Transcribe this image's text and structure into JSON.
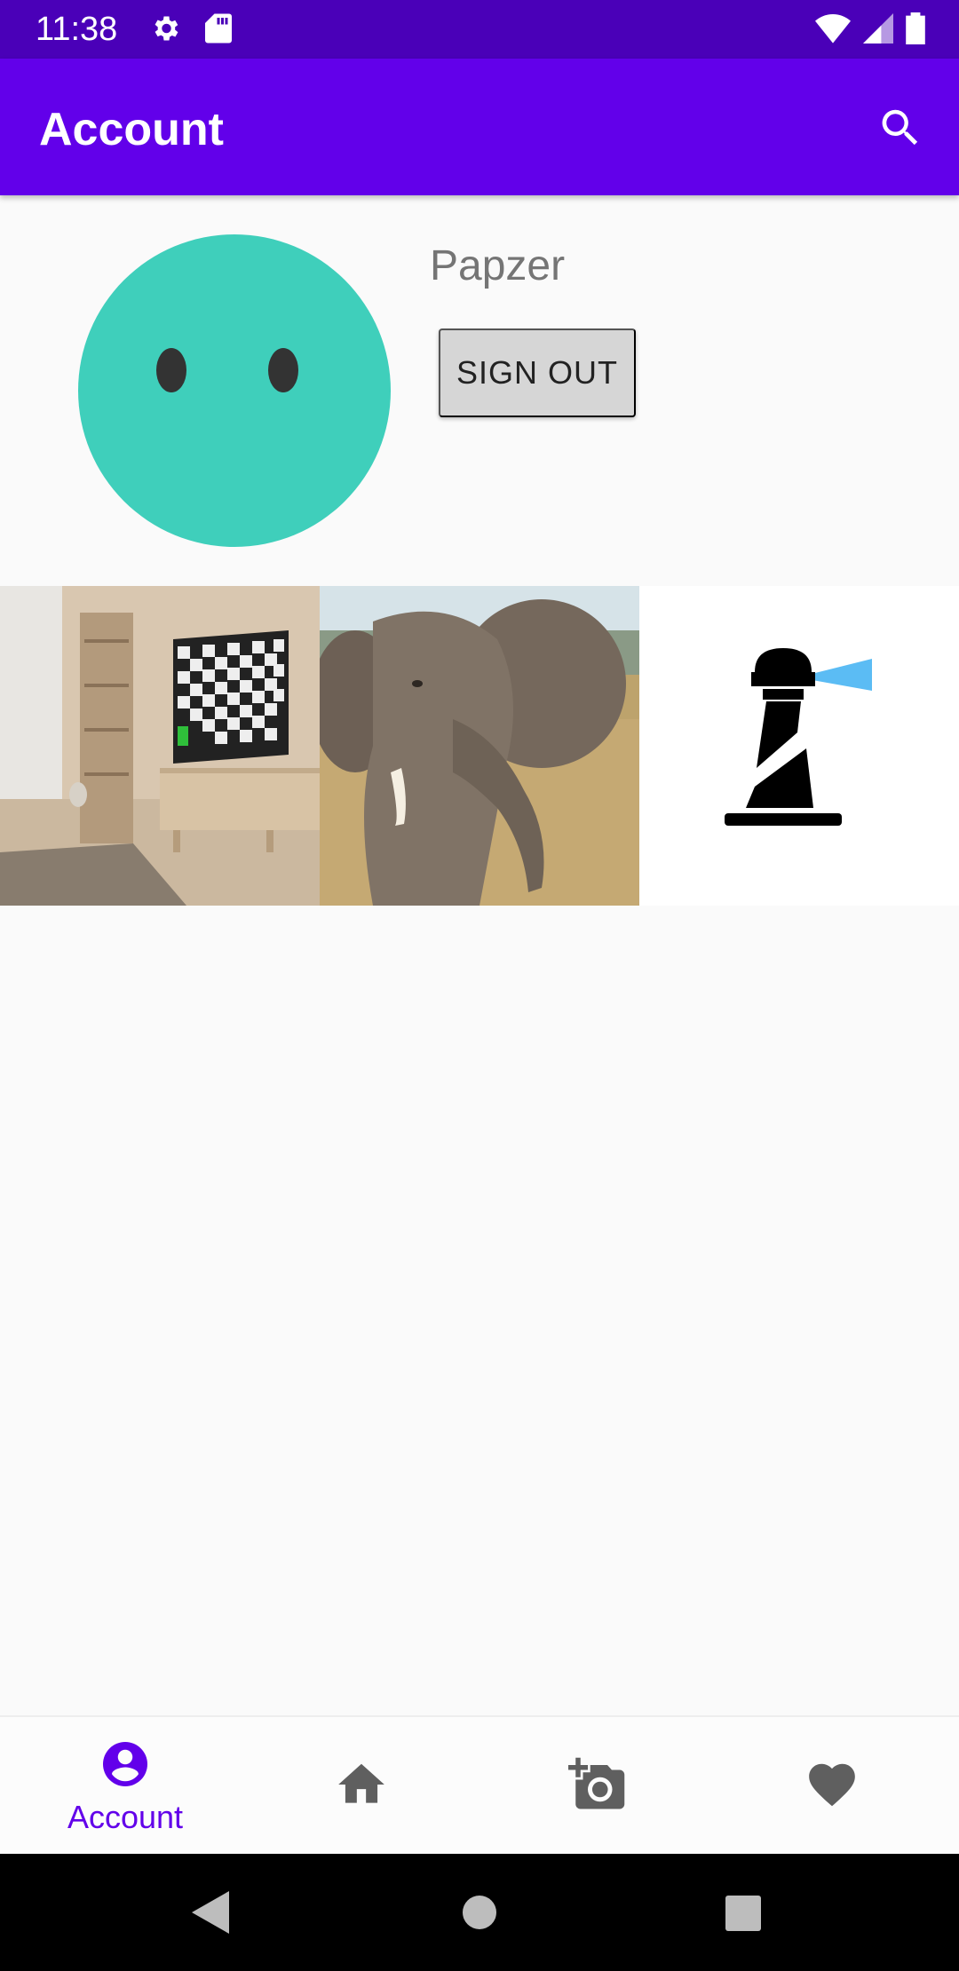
{
  "status_bar": {
    "time": "11:38",
    "icons": [
      "settings-icon",
      "sd-card-icon",
      "wifi-icon",
      "signal-icon",
      "battery-icon"
    ]
  },
  "app_bar": {
    "title": "Account",
    "actions": [
      "search-icon"
    ],
    "color": "#6200ea"
  },
  "profile": {
    "username": "Papzer",
    "sign_out_label": "SIGN OUT",
    "avatar_color": "#3fcfbb"
  },
  "gallery": {
    "items": [
      {
        "name": "living-room-tv-photo"
      },
      {
        "name": "elephant-photo"
      },
      {
        "name": "lighthouse-image"
      }
    ]
  },
  "bottom_nav": {
    "items": [
      {
        "label": "Account",
        "icon": "account-circle-icon",
        "selected": true
      },
      {
        "label": "",
        "icon": "home-icon",
        "selected": false
      },
      {
        "label": "",
        "icon": "add-photo-icon",
        "selected": false
      },
      {
        "label": "",
        "icon": "heart-icon",
        "selected": false
      }
    ],
    "active_color": "#6200ea",
    "inactive_color": "#5f5f5f"
  },
  "system_nav": {
    "buttons": [
      "back-icon",
      "home-circle-icon",
      "recents-icon"
    ]
  }
}
